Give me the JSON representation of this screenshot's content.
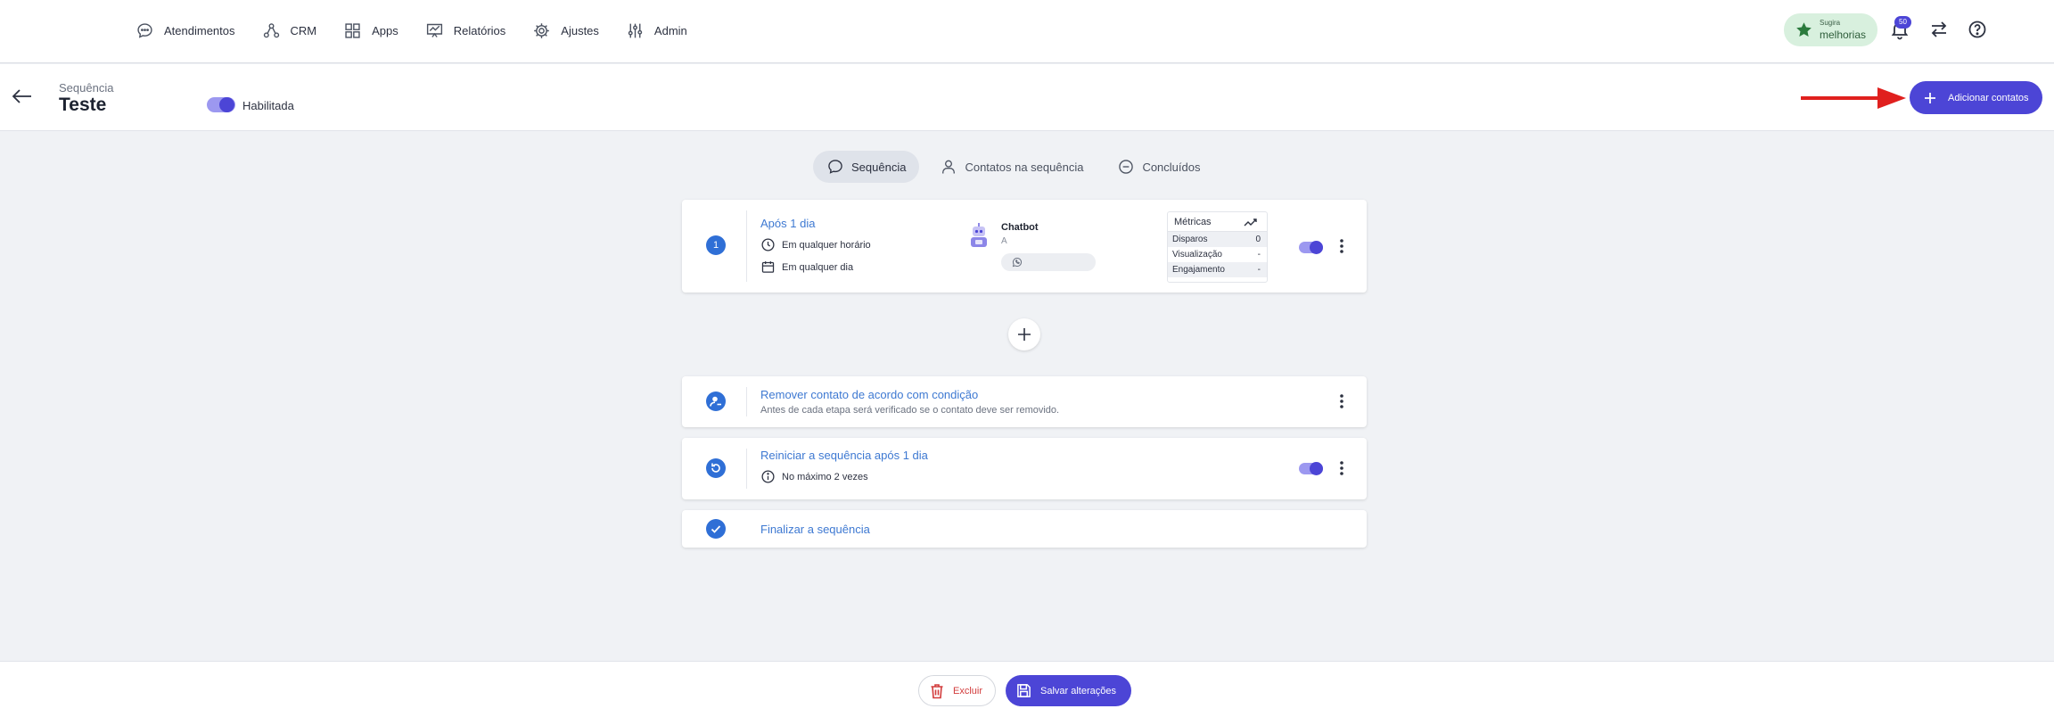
{
  "nav": {
    "items": [
      {
        "label": "Atendimentos",
        "icon": "chat-bubble-icon"
      },
      {
        "label": "CRM",
        "icon": "crm-nodes-icon"
      },
      {
        "label": "Apps",
        "icon": "apps-grid-icon"
      },
      {
        "label": "Relatórios",
        "icon": "reports-chart-icon"
      },
      {
        "label": "Ajustes",
        "icon": "gear-icon"
      },
      {
        "label": "Admin",
        "icon": "sliders-icon"
      }
    ],
    "sugira_line1": "Sugira",
    "sugira_line2": "melhorias",
    "notification_count": "50"
  },
  "header": {
    "label": "Sequência",
    "title": "Teste",
    "enabled_label": "Habilitada",
    "enabled": true,
    "add_contacts_label": "Adicionar contatos"
  },
  "tabs": [
    {
      "label": "Sequência",
      "icon": "chat-bubble-icon",
      "active": true
    },
    {
      "label": "Contatos na sequência",
      "icon": "user-icon",
      "active": false
    },
    {
      "label": "Concluídos",
      "icon": "minus-circle-icon",
      "active": false
    }
  ],
  "step1": {
    "number": "1",
    "title": "Após 1 dia",
    "time_rule": "Em qualquer horário",
    "day_rule": "Em qualquer dia",
    "bot_name": "Chatbot",
    "bot_sub": "A",
    "channel_icon": "whatsapp-icon",
    "enabled": true,
    "metrics": {
      "title": "Métricas",
      "rows": [
        {
          "label": "Disparos",
          "value": "0"
        },
        {
          "label": "Visualização",
          "value": "-"
        },
        {
          "label": "Engajamento",
          "value": "-"
        }
      ]
    }
  },
  "remove_rule": {
    "title": "Remover contato de acordo com condição",
    "desc": "Antes de cada etapa será verificado se o contato deve ser removido."
  },
  "restart_rule": {
    "title": "Reiniciar a sequência após 1 dia",
    "limit": "No máximo 2 vezes",
    "enabled": true
  },
  "finish_rule": {
    "title": "Finalizar a sequência"
  },
  "footer": {
    "delete_label": "Excluir",
    "save_label": "Salvar alterações"
  },
  "colors": {
    "primary": "#4c45d6",
    "link": "#3e79d2",
    "step_blue": "#2f6fd6",
    "danger": "#d23b3b",
    "background": "#f0f2f5"
  }
}
